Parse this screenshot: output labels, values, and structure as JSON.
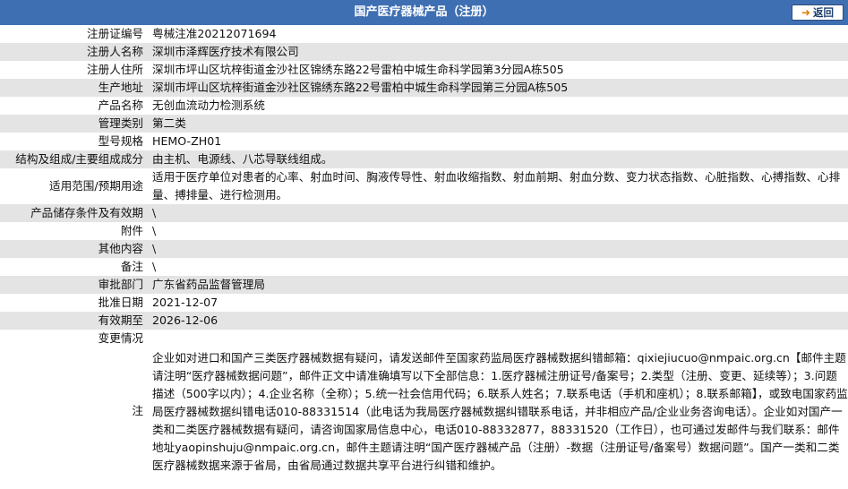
{
  "header": {
    "title": "国产医疗器械产品（注册）",
    "back_label": "返回"
  },
  "fields": [
    {
      "label": "注册证编号",
      "value": "粤械注准20212071694"
    },
    {
      "label": "注册人名称",
      "value": "深圳市泽辉医疗技术有限公司"
    },
    {
      "label": "注册人住所",
      "value": "深圳市坪山区坑梓街道金沙社区锦绣东路22号雷柏中城生命科学园第3分园A栋505"
    },
    {
      "label": "生产地址",
      "value": "深圳市坪山区坑梓街道金沙社区锦绣东路22号雷柏中城生命科学园第三分园A栋505"
    },
    {
      "label": "产品名称",
      "value": "无创血流动力检测系统"
    },
    {
      "label": "管理类别",
      "value": "第二类"
    },
    {
      "label": "型号规格",
      "value": "HEMO-ZH01"
    },
    {
      "label": "结构及组成/主要组成成分",
      "value": "由主机、电源线、八芯导联线组成。"
    },
    {
      "label": "适用范围/预期用途",
      "value": "适用于医疗单位对患者的心率、射血时间、胸液传导性、射血收缩指数、射血前期、射血分数、变力状态指数、心脏指数、心搏指数、心排量、搏排量、进行检测用。"
    },
    {
      "label": "产品储存条件及有效期",
      "value": "\\"
    },
    {
      "label": "附件",
      "value": "\\"
    },
    {
      "label": "其他内容",
      "value": "\\"
    },
    {
      "label": "备注",
      "value": "\\"
    },
    {
      "label": "审批部门",
      "value": "广东省药品监督管理局"
    },
    {
      "label": "批准日期",
      "value": "2021-12-07"
    },
    {
      "label": "有效期至",
      "value": "2026-12-06"
    },
    {
      "label": "变更情况",
      "value": ""
    },
    {
      "label": "注",
      "value": "企业如对进口和国产三类医疗器械数据有疑问，请发送邮件至国家药监局医疗器械数据纠错邮箱：qixiejiucuo@nmpaic.org.cn【邮件主题请注明“医疗器械数据问题”，邮件正文中请准确填写以下全部信息：1.医疗器械注册证号/备案号；2.类型（注册、变更、延续等）；3.问题描述（500字以内）；4.企业名称（全称）；5.统一社会信用代码；6.联系人姓名；7.联系电话（手机和座机）；8.联系邮箱】，或致电国家药监局医疗器械数据纠错电话010-88331514（此电话为我局医疗器械数据纠错联系电话，并非相应产品/企业业务咨询电话）。企业如对国产一类和二类医疗器械数据有疑问，请咨询国家局信息中心，电话010-88332877，88331520（工作日），也可通过发邮件与我们联系：邮件地址yaopinshuju@nmpaic.org.cn，邮件主题请注明“国产医疗器械产品（注册）-数据（注册证号/备案号）数据问题”。国产一类和二类医疗器械数据来源于省局，由省局通过数据共享平台进行纠错和维护。"
    }
  ]
}
